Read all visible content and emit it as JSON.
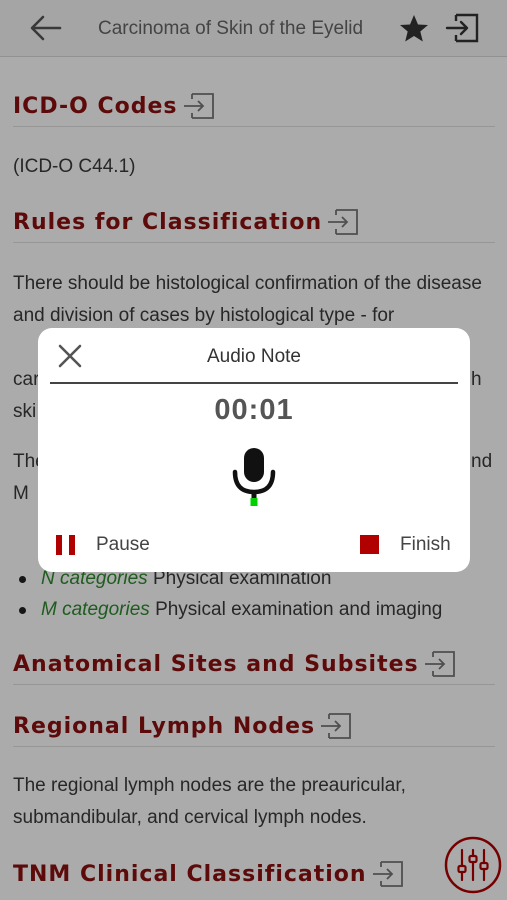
{
  "nav": {
    "title": "Carcinoma of Skin of the Eyelid",
    "back_icon": "back-arrow-icon",
    "star_icon": "star-icon",
    "export_icon": "export-icon"
  },
  "sections": {
    "icdo": {
      "heading": "ICD-O Codes",
      "text": "(ICD-O C44.1)"
    },
    "rules": {
      "heading": "Rules for Classification",
      "text": "There should be histological confirmation of the disease and division of cases by histological type - for",
      "frag1": "car",
      "frag2": "h",
      "frag3": "ski",
      "frag4": "The",
      "frag5": "nd",
      "frag6": "M"
    },
    "bullets": [
      {
        "term": "N categories",
        "desc": "Physical examination"
      },
      {
        "term": "M categories",
        "desc": "Physical examination and imaging"
      }
    ],
    "sites": {
      "heading": "Anatomical Sites and Subsites"
    },
    "nodes": {
      "heading": "Regional Lymph Nodes",
      "text": "The regional lymph nodes are the preauricular, submandibular, and cervical lymph nodes."
    },
    "tnm": {
      "heading": "TNM Clinical Classification"
    }
  },
  "modal": {
    "title": "Audio Note",
    "timer": "00:01",
    "pause_label": "Pause",
    "finish_label": "Finish",
    "close_icon": "close-icon",
    "mic_icon": "microphone-icon",
    "pause_icon": "pause-icon",
    "stop_icon": "stop-icon"
  },
  "colors": {
    "heading": "#8b0f0f",
    "accent_red": "#b00000",
    "term_green": "#2f8a2f",
    "level_green": "#00d000"
  }
}
